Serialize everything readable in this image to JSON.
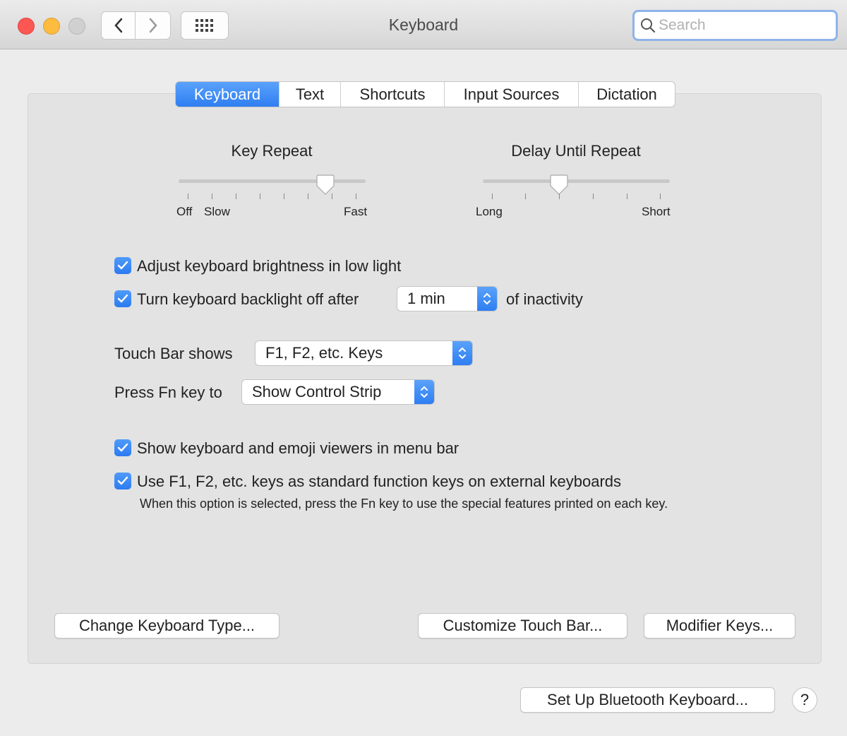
{
  "window": {
    "title": "Keyboard"
  },
  "toolbar": {
    "search_placeholder": "Search"
  },
  "tabs": [
    {
      "label": "Keyboard",
      "active": true
    },
    {
      "label": "Text",
      "active": false
    },
    {
      "label": "Shortcuts",
      "active": false
    },
    {
      "label": "Input Sources",
      "active": false
    },
    {
      "label": "Dictation",
      "active": false
    }
  ],
  "key_repeat": {
    "title": "Key Repeat",
    "labels": {
      "off": "Off",
      "slow": "Slow",
      "fast": "Fast"
    },
    "level": 0.82
  },
  "delay_until_repeat": {
    "title": "Delay Until Repeat",
    "labels": {
      "long": "Long",
      "short": "Short"
    },
    "level": 0.4
  },
  "options": {
    "brightness": {
      "label": "Adjust keyboard brightness in low light",
      "checked": true
    },
    "backlight": {
      "label": "Turn keyboard backlight off after",
      "checked": true,
      "value": "1 min",
      "suffix": "of inactivity"
    },
    "touch_bar": {
      "label": "Touch Bar shows",
      "value": "F1, F2, etc. Keys"
    },
    "fn_key": {
      "label": "Press Fn key to",
      "value": "Show Control Strip"
    },
    "viewers": {
      "label": "Show keyboard and emoji viewers in menu bar",
      "checked": true
    },
    "function_keys": {
      "label": "Use F1, F2, etc. keys as standard function keys on external keyboards",
      "checked": true,
      "note": "When this option is selected, press the Fn key to use the special features printed on each key."
    }
  },
  "buttons": {
    "change_type": "Change Keyboard Type...",
    "customize_touch_bar": "Customize Touch Bar...",
    "modifier_keys": "Modifier Keys...",
    "bluetooth": "Set Up Bluetooth Keyboard...",
    "help": "?"
  },
  "colors": {
    "accent": "#2f7ef2"
  }
}
